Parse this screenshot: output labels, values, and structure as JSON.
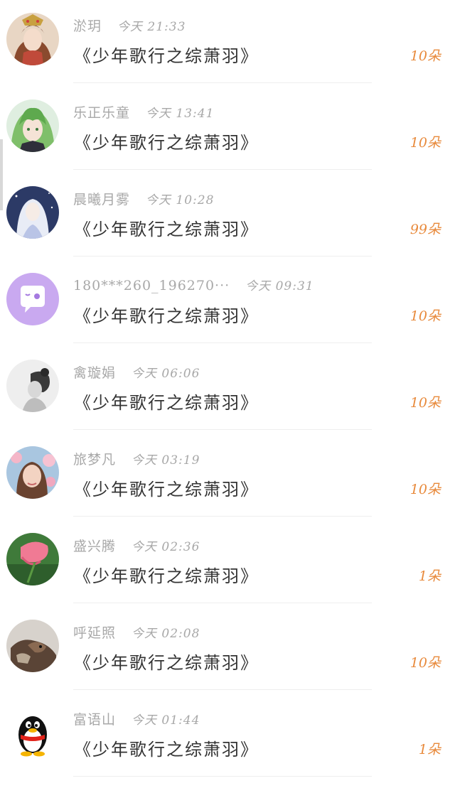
{
  "gift_list": [
    {
      "name": "淤玥",
      "time": "今天 21:33",
      "title": "《少年歌行之综萧羽》",
      "amount": "10朵",
      "avatar": "anime-girl-headdress-avatar"
    },
    {
      "name": "乐正乐童",
      "time": "今天 13:41",
      "title": "《少年歌行之综萧羽》",
      "amount": "10朵",
      "avatar": "green-hair-anime-avatar"
    },
    {
      "name": "晨曦月雾",
      "time": "今天 10:28",
      "title": "《少年歌行之综萧羽》",
      "amount": "99朵",
      "avatar": "white-hair-anime-avatar"
    },
    {
      "name": "180***260_196270···",
      "time": "今天 09:31",
      "title": "《少年歌行之综萧羽》",
      "amount": "10朵",
      "avatar": "purple-chat-default-avatar"
    },
    {
      "name": "禽璇娟",
      "time": "今天 06:06",
      "title": "《少年歌行之综萧羽》",
      "amount": "10朵",
      "avatar": "grayscale-portrait-avatar"
    },
    {
      "name": "旅梦凡",
      "time": "今天 03:19",
      "title": "《少年歌行之综萧羽》",
      "amount": "10朵",
      "avatar": "woman-flowers-avatar"
    },
    {
      "name": "盛兴腾",
      "time": "今天 02:36",
      "title": "《少年歌行之综萧羽》",
      "amount": "1朵",
      "avatar": "pink-flower-avatar"
    },
    {
      "name": "呼延照",
      "time": "今天 02:08",
      "title": "《少年歌行之综萧羽》",
      "amount": "10朵",
      "avatar": "dog-photo-avatar"
    },
    {
      "name": "富语山",
      "time": "今天 01:44",
      "title": "《少年歌行之综萧羽》",
      "amount": "1朵",
      "avatar": "qq-penguin-avatar"
    }
  ],
  "colors": {
    "amount": "#e88a3c",
    "meta": "#a8a8a8",
    "title": "#333333",
    "divider": "#eeeeee",
    "default_avatar": "#c9a9f0"
  }
}
